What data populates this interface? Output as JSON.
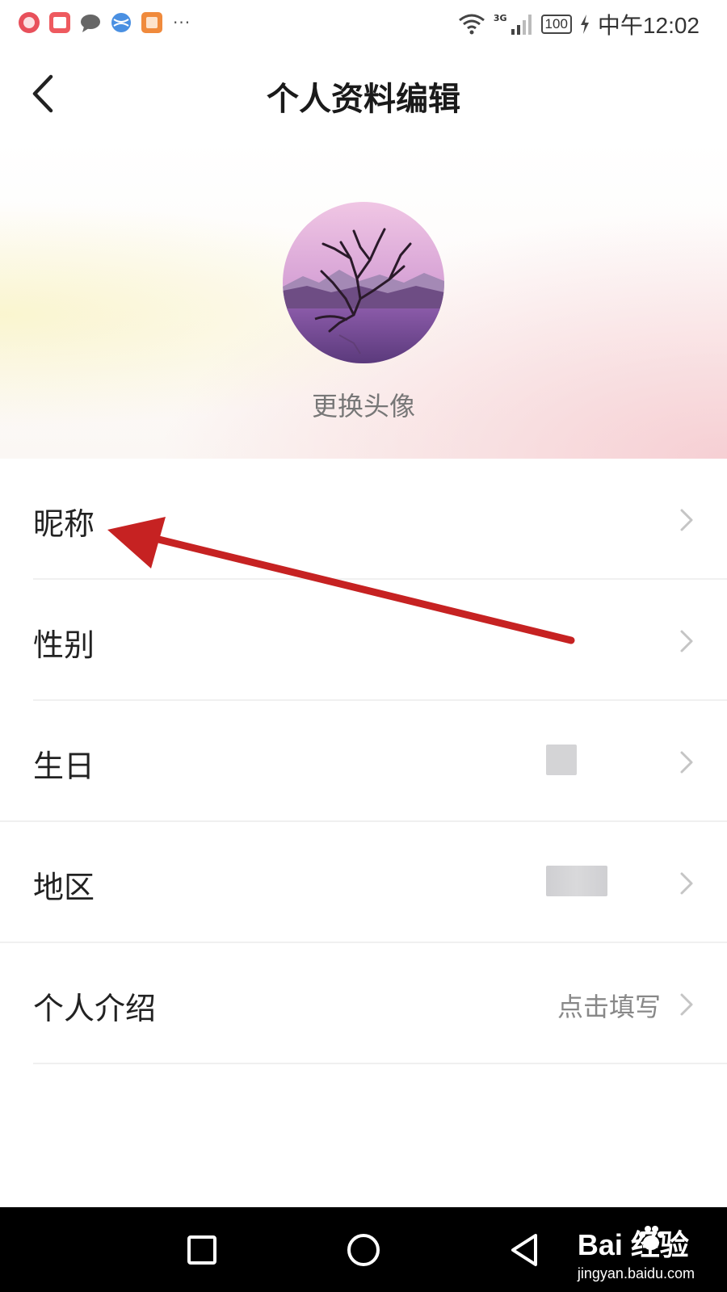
{
  "status_bar": {
    "network": "3G",
    "battery": "100",
    "time": "中午12:02",
    "more_indicator": "···",
    "notification_icons": [
      "weibo-icon",
      "reader-icon",
      "message-icon",
      "browser-icon",
      "mokao-icon"
    ]
  },
  "header": {
    "title": "个人资料编辑",
    "back_icon": "chevron-left-icon"
  },
  "profile": {
    "avatar_description": "avatar-image",
    "change_avatar_label": "更换头像"
  },
  "settings": {
    "items": [
      {
        "label": "昵称",
        "value": ""
      },
      {
        "label": "性别",
        "value": ""
      },
      {
        "label": "生日",
        "value": ""
      },
      {
        "label": "地区",
        "value": ""
      },
      {
        "label": "个人介绍",
        "value": "点击填写"
      }
    ]
  },
  "system_nav": {
    "buttons": [
      "recent-apps-icon",
      "home-icon",
      "back-triangle-icon"
    ]
  },
  "watermark": {
    "brand": "Bai  经验",
    "url": "jingyan.baidu.com"
  },
  "colors": {
    "annotation_arrow": "#c62222",
    "title_text": "#1a1a1a",
    "secondary_text": "#888888"
  }
}
